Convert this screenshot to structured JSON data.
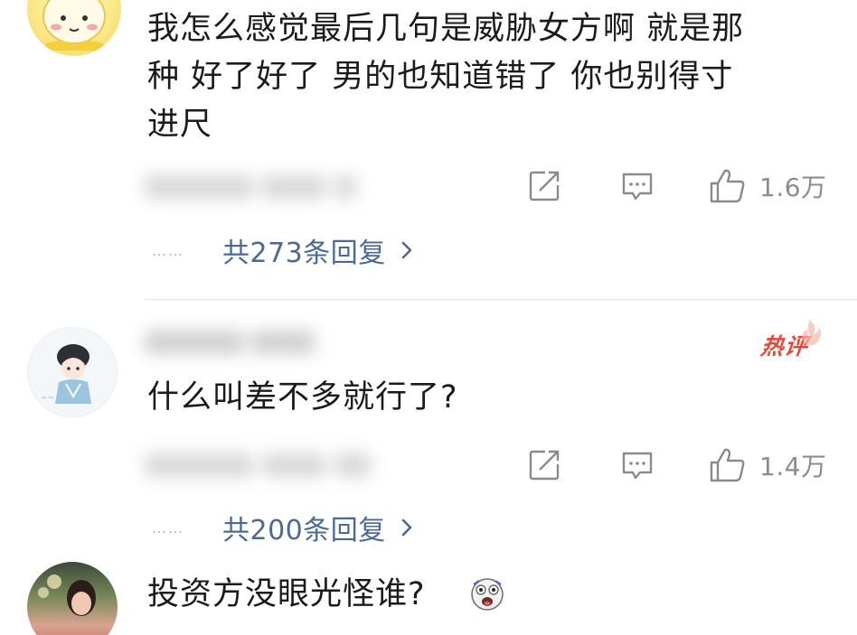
{
  "comments": [
    {
      "lines": [
        "我怎么感觉最后几句是威胁女方啊  就是那",
        "种  好了好了  男的也知道错了  你也别得寸",
        "进尺"
      ],
      "likes": "1.6万",
      "replies_label": "共273条回复",
      "avatar": "avatar-cartoon-yellow"
    },
    {
      "text": "什么叫差不多就行了?",
      "likes": "1.4万",
      "replies_label": "共200条回复",
      "badge": "热评",
      "avatar": "avatar-cartoon-girl"
    },
    {
      "text": "投资方没眼光怪谁?",
      "emoji": "shocked-face-emoji",
      "avatar": "avatar-photo-woman"
    }
  ],
  "icons": {
    "share": "share-icon",
    "reply": "reply-icon",
    "like": "thumbs-up-icon",
    "chevron": "chevron-right-icon"
  },
  "colors": {
    "reply_link": "#4a6a93",
    "hot_badge": "#e24a3b",
    "icon_gray": "#8a8a8a"
  },
  "dots": "……"
}
